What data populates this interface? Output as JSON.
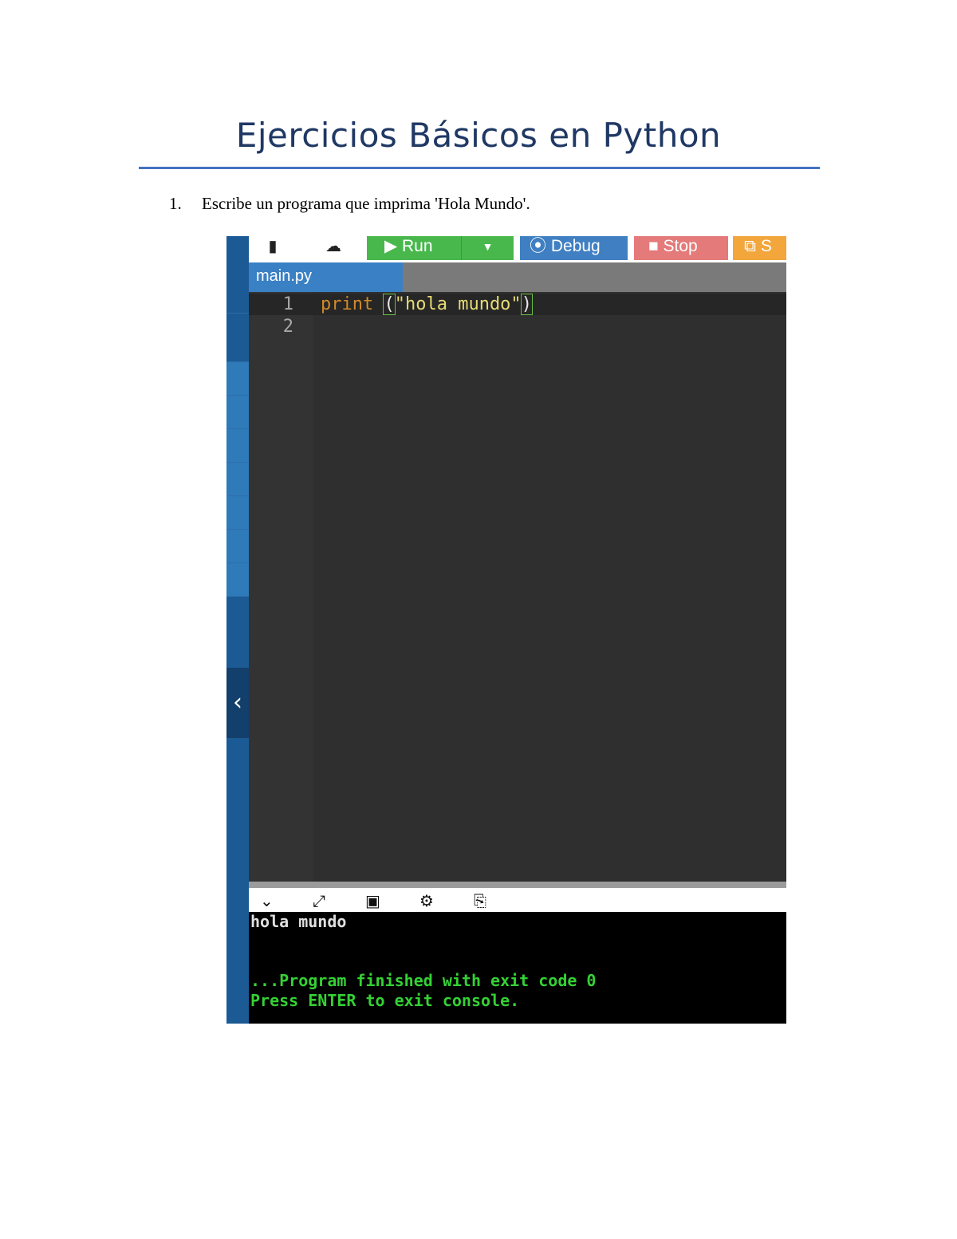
{
  "document": {
    "title": "Ejercicios Básicos en Python",
    "exercise_number": "1.",
    "exercise_text": "Escribe un programa que imprima 'Hola Mundo'."
  },
  "ide": {
    "toolbar": {
      "new_file_icon": "file-icon",
      "upload_icon": "cloud-upload-icon",
      "run_label": "Run",
      "debug_label": "Debug",
      "stop_label": "Stop",
      "share_label": "S"
    },
    "tab": {
      "filename": "main.py"
    },
    "editor": {
      "line_numbers": [
        "1",
        "2"
      ],
      "code_keyword": "print",
      "code_space": " ",
      "code_open": "(",
      "code_string": "\"hola mundo\"",
      "code_close": ")"
    },
    "terminal": {
      "output": "hola mundo",
      "finished": "...Program finished with exit code 0",
      "press_enter": "Press ENTER to exit console."
    },
    "colors": {
      "run": "#48b84c",
      "debug": "#3f7fc2",
      "stop": "#e47a7a",
      "share": "#f2a63b",
      "sidebar": "#1b5a94"
    }
  }
}
